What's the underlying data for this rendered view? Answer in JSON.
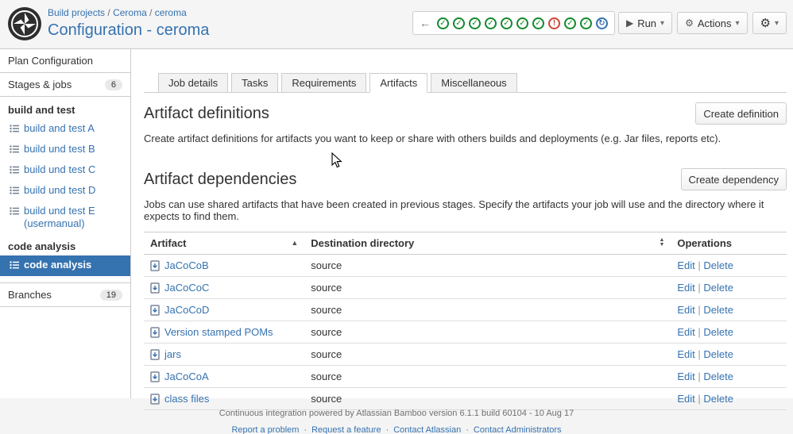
{
  "header": {
    "breadcrumb": [
      "Build projects",
      "Ceroma",
      "ceroma"
    ],
    "title": "Configuration - ceroma",
    "run_label": "Run",
    "actions_label": "Actions"
  },
  "status_strip": {
    "statuses": [
      "success",
      "success",
      "success",
      "success",
      "success",
      "success",
      "success",
      "fail",
      "success",
      "success",
      "building"
    ]
  },
  "sidebar": {
    "plan_configuration": "Plan Configuration",
    "stages_and_jobs": "Stages & jobs",
    "stages_badge": "6",
    "groups": [
      {
        "heading": "build and test",
        "items": [
          {
            "label": "build and test A",
            "selected": false
          },
          {
            "label": "build und test B",
            "selected": false
          },
          {
            "label": "build und test C",
            "selected": false
          },
          {
            "label": "build und test D",
            "selected": false
          },
          {
            "label": "build und test E (usermanual)",
            "selected": false
          }
        ]
      },
      {
        "heading": "code analysis",
        "items": [
          {
            "label": "code analysis",
            "selected": true
          }
        ]
      }
    ],
    "branches": "Branches",
    "branches_badge": "19"
  },
  "tabs": {
    "items": [
      "Job details",
      "Tasks",
      "Requirements",
      "Artifacts",
      "Miscellaneous"
    ],
    "active": "Artifacts"
  },
  "definitions": {
    "title": "Artifact definitions",
    "button": "Create definition",
    "description": "Create artifact definitions for artifacts you want to keep or share with others builds and deployments (e.g. Jar files, reports etc)."
  },
  "dependencies": {
    "title": "Artifact dependencies",
    "button": "Create dependency",
    "description": "Jobs can use shared artifacts that have been created in previous stages. Specify the artifacts your job will use and the directory where it expects to find them.",
    "table": {
      "columns": [
        "Artifact",
        "Destination directory",
        "Operations"
      ],
      "rows": [
        {
          "artifact": "JaCoCoB",
          "destination": "source",
          "operations": [
            "Edit",
            "Delete"
          ]
        },
        {
          "artifact": "JaCoCoC",
          "destination": "source",
          "operations": [
            "Edit",
            "Delete"
          ]
        },
        {
          "artifact": "JaCoCoD",
          "destination": "source",
          "operations": [
            "Edit",
            "Delete"
          ]
        },
        {
          "artifact": "Version stamped POMs",
          "destination": "source",
          "operations": [
            "Edit",
            "Delete"
          ]
        },
        {
          "artifact": "jars",
          "destination": "source",
          "operations": [
            "Edit",
            "Delete"
          ]
        },
        {
          "artifact": "JaCoCoA",
          "destination": "source",
          "operations": [
            "Edit",
            "Delete"
          ]
        },
        {
          "artifact": "class files",
          "destination": "source",
          "operations": [
            "Edit",
            "Delete"
          ]
        }
      ]
    }
  },
  "footer": {
    "text": "Continuous integration powered by Atlassian Bamboo version 6.1.1 build 60104 - 10 Aug 17",
    "links": [
      "Report a problem",
      "Request a feature",
      "Contact Atlassian",
      "Contact Administrators"
    ]
  }
}
